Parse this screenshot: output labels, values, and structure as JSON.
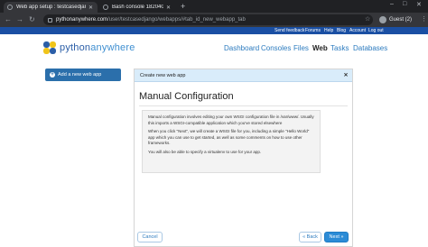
{
  "browser": {
    "tabs": [
      {
        "title": "Web app setup : testcasedjango",
        "active": true
      },
      {
        "title": "Bash console 18204043 : testc",
        "active": false
      }
    ],
    "new_tab_glyph": "+",
    "window_controls": [
      "–",
      "□",
      "✕"
    ],
    "address": {
      "host": "pythonanywhere.com",
      "path": "/user/testcasedjango/webapps/#tab_id_new_webapp_tab"
    },
    "profile_label": "Guest (2)"
  },
  "site": {
    "top_links": [
      "Send feedback",
      "Forums",
      "Help",
      "Blog",
      "Account",
      "Log out"
    ],
    "logo": {
      "part1": "python",
      "part2": "anywhere"
    },
    "nav": [
      {
        "label": "Dashboard",
        "active": false
      },
      {
        "label": "Consoles",
        "active": false
      },
      {
        "label": "Files",
        "active": false
      },
      {
        "label": "Web",
        "active": true
      },
      {
        "label": "Tasks",
        "active": false
      },
      {
        "label": "Databases",
        "active": false
      }
    ],
    "sidebar": {
      "add_button_label": "Add a new web app"
    }
  },
  "modal": {
    "header": "Create new web app",
    "close_glyph": "✕",
    "title": "Manual Configuration",
    "paragraphs": [
      "Manual configuration involves editing your own WSGI configuration file in /var/www/. Usually this imports a WSGI-compatible application which you've stored elsewhere",
      "When you click \"Next\", we will create a WSGI file for you, including a simple \"Hello World\" app which you can use to get started, as well as some comments on how to use other frameworks.",
      "You will also be able to specify a virtualenv to use for your app."
    ],
    "cancel_label": "Cancel",
    "back_label": "« Back",
    "next_label": "Next »"
  },
  "colors": {
    "top_bar": "#1a4fa3",
    "link": "#2c7bbf",
    "primary_button": "#2b8bd6",
    "modal_header": "#d9ecfa"
  }
}
